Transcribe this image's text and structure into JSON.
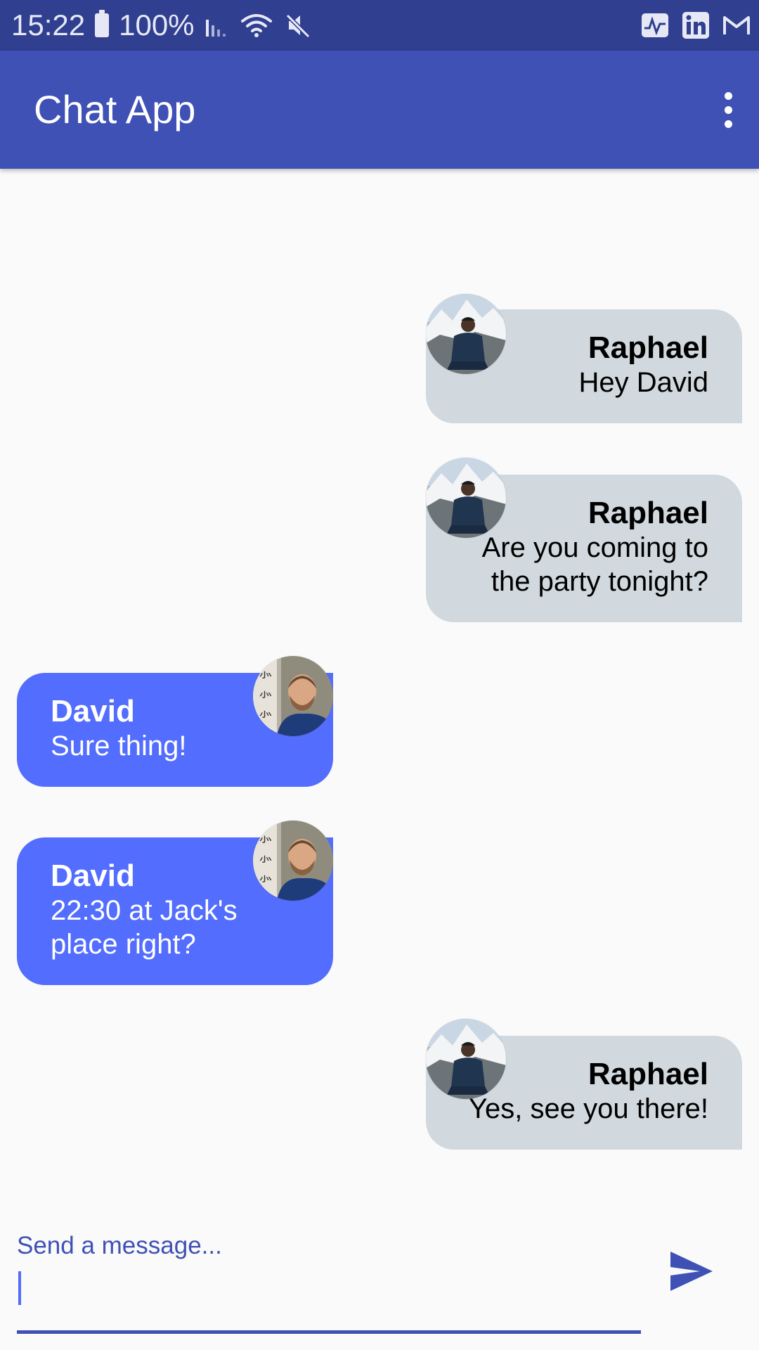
{
  "status_bar": {
    "time": "15:22",
    "battery": "100%"
  },
  "app_bar": {
    "title": "Chat App"
  },
  "messages": [
    {
      "sender": "Raphael",
      "text": "Hey David",
      "side": "right"
    },
    {
      "sender": "Raphael",
      "text": "Are you coming to the party tonight?",
      "side": "right"
    },
    {
      "sender": "David",
      "text": "Sure thing!",
      "side": "left"
    },
    {
      "sender": "David",
      "text": "22:30 at Jack's place right?",
      "side": "left"
    },
    {
      "sender": "Raphael",
      "text": "Yes, see you there!",
      "side": "right"
    }
  ],
  "composer": {
    "placeholder": "Send a message...",
    "value": ""
  },
  "colors": {
    "primary": "#3f51b5",
    "primary_dark": "#303f8f",
    "accent": "#536dfe",
    "my_bubble": "#d1d9de",
    "background": "#fafafa"
  },
  "icons": [
    "battery-icon",
    "signal-icon",
    "wifi-icon",
    "mute-icon",
    "activity-icon",
    "linkedin-icon",
    "gmail-icon",
    "overflow-menu-icon",
    "send-icon"
  ]
}
